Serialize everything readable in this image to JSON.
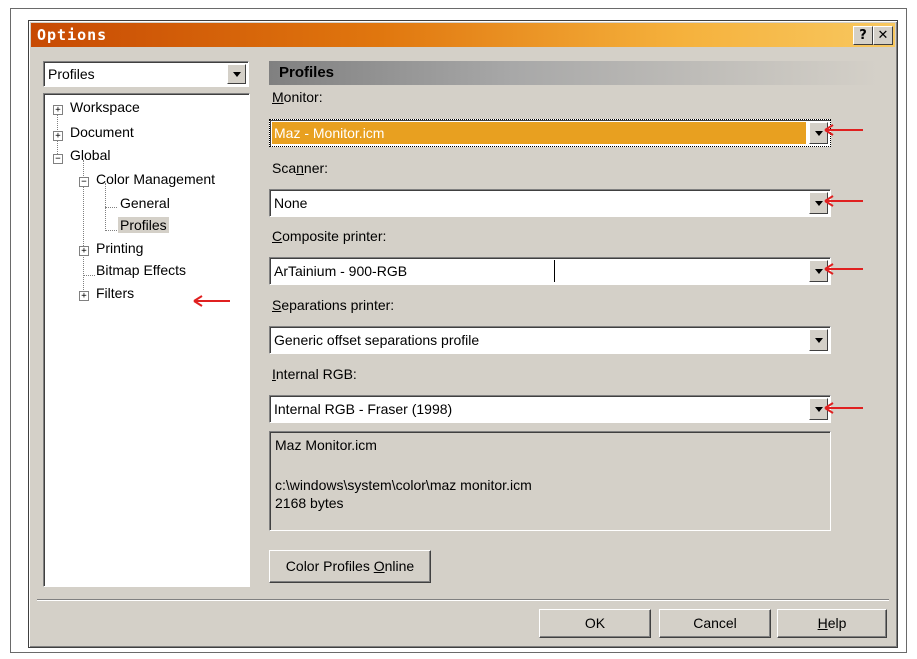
{
  "window": {
    "title": "Options",
    "help_glyph": "?",
    "close_glyph": "✕"
  },
  "left": {
    "category_select": "Profiles",
    "tree": {
      "workspace": "Workspace",
      "document": "Document",
      "global": "Global",
      "color_management": "Color Management",
      "general": "General",
      "profiles": "Profiles",
      "printing": "Printing",
      "bitmap_effects": "Bitmap Effects",
      "filters": "Filters"
    }
  },
  "panel": {
    "header": "Profiles",
    "monitor": {
      "label_pre": "",
      "label_key": "M",
      "label_post": "onitor:",
      "value": "Maz - Monitor.icm"
    },
    "scanner": {
      "label_pre": "Sca",
      "label_key": "n",
      "label_post": "ner:",
      "value": "None"
    },
    "composite": {
      "label_pre": "",
      "label_key": "C",
      "label_post": "omposite printer:",
      "value": "ArTainium - 900-RGB"
    },
    "separations": {
      "label_pre": "",
      "label_key": "S",
      "label_post": "eparations printer:",
      "value": "Generic offset separations profile"
    },
    "internal": {
      "label_pre": "",
      "label_key": "I",
      "label_post": "nternal RGB:",
      "value": "Internal RGB - Fraser (1998)"
    },
    "info": {
      "name": "Maz Monitor.icm",
      "path": "c:\\windows\\system\\color\\maz monitor.icm",
      "size": "2168 bytes"
    },
    "online_button": {
      "pre": "Color Profiles ",
      "key": "O",
      "post": "nline"
    }
  },
  "footer": {
    "ok": "OK",
    "cancel": "Cancel",
    "help_key": "H",
    "help_post": "elp"
  },
  "colors": {
    "annotation_arrow": "#e02020",
    "title_gradient_start": "#c74a04",
    "title_gradient_end": "#f8c860",
    "highlight": "#e8a020"
  }
}
